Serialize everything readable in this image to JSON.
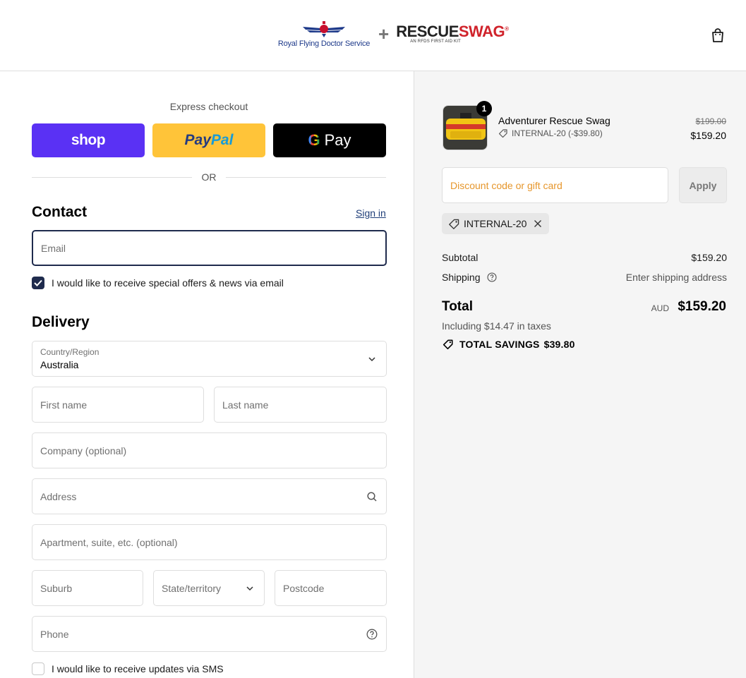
{
  "header": {
    "rfds_name": "Royal Flying Doctor Service",
    "plus": "+",
    "rescue_brand_a": "RESCUE",
    "rescue_brand_b": "SWAG",
    "rescue_reg": "®",
    "rescue_tagline": "AN RFDS FIRST AID KIT",
    "cart_icon": "shopping-bag-icon"
  },
  "express": {
    "title": "Express checkout",
    "shop_label": "shop",
    "paypal_a": "Pay",
    "paypal_b": "Pal",
    "gpay_g": "G",
    "gpay_label": "Pay",
    "or_label": "OR"
  },
  "contact": {
    "title": "Contact",
    "signin_label": "Sign in",
    "email_placeholder": "Email",
    "offers_label": "I would like to receive special offers & news via email",
    "offers_checked": true
  },
  "delivery": {
    "title": "Delivery",
    "country_label": "Country/Region",
    "country_value": "Australia",
    "first_name": "First name",
    "last_name": "Last name",
    "company": "Company (optional)",
    "address": "Address",
    "apartment": "Apartment, suite, etc. (optional)",
    "suburb": "Suburb",
    "state": "State/territory",
    "postcode": "Postcode",
    "phone": "Phone",
    "sms_label": "I would like to receive updates via SMS",
    "sms_checked": false
  },
  "summary": {
    "item": {
      "name": "Adventurer Rescue Swag",
      "quantity": "1",
      "discount_label": "INTERNAL-20 (-$39.80)",
      "price_original": "$199.00",
      "price_final": "$159.20"
    },
    "discount_placeholder": "Discount code or gift card",
    "apply_label": "Apply",
    "applied_code": "INTERNAL-20",
    "subtotal_label": "Subtotal",
    "subtotal_value": "$159.20",
    "shipping_label": "Shipping",
    "shipping_value": "Enter shipping address",
    "total_label": "Total",
    "total_currency": "AUD",
    "total_value": "$159.20",
    "tax_note": "Including $14.47 in taxes",
    "savings_label": "TOTAL SAVINGS",
    "savings_value": "$39.80"
  },
  "colors": {
    "shop_brand": "#5a31f4",
    "paypal_brand": "#ffc439",
    "gpay_brand": "#000000",
    "accent_dark": "#1f2b4d",
    "discount_placeholder": "#e6962b"
  }
}
